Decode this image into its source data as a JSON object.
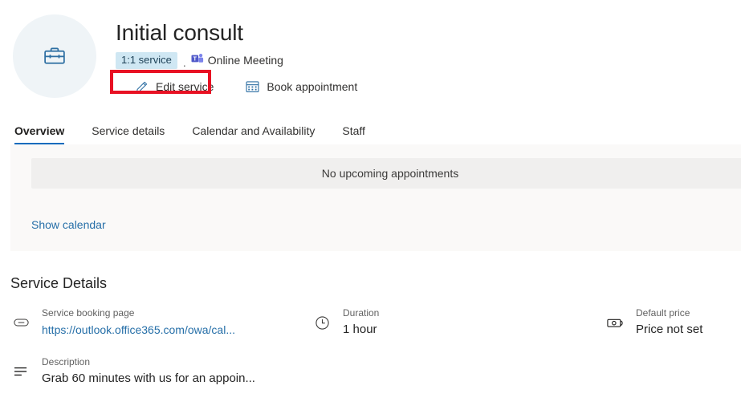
{
  "header": {
    "avatar_icon": "briefcase-icon",
    "title": "Initial consult",
    "badge": "1:1 service",
    "separator": ".",
    "meeting_type": "Online Meeting",
    "meeting_icon": "teams-icon",
    "edit_service_label": "Edit service",
    "edit_service_icon": "pencil-icon",
    "book_appointment_label": "Book appointment",
    "book_appointment_icon": "calendar-icon"
  },
  "annotation": {
    "color": "#e81123",
    "target": "edit-service-button"
  },
  "tabs": [
    {
      "label": "Overview",
      "active": true
    },
    {
      "label": "Service details",
      "active": false
    },
    {
      "label": "Calendar and Availability",
      "active": false
    },
    {
      "label": "Staff",
      "active": false
    }
  ],
  "appointments": {
    "empty_text": "No upcoming appointments",
    "show_calendar_label": "Show calendar"
  },
  "service_details": {
    "section_title": "Service Details",
    "items": [
      {
        "icon": "link-icon",
        "label": "Service booking page",
        "value": "https://outlook.office365.com/owa/cal...",
        "is_link": true
      },
      {
        "icon": "description-icon",
        "label": "Description",
        "value": "Grab 60 minutes with us for an appoin...",
        "is_link": false
      },
      {
        "icon": "clock-icon",
        "label": "Duration",
        "value": "1 hour",
        "is_link": false
      },
      {
        "icon": "money-icon",
        "label": "Default price",
        "value": "Price not set",
        "is_link": false
      }
    ]
  },
  "colors": {
    "accent": "#0f6cbd",
    "link": "#266fa8",
    "badge_bg": "#cfe7f3",
    "panel_bg": "#faf9f8",
    "empty_bg": "#f0efee",
    "annotation": "#e81123"
  }
}
